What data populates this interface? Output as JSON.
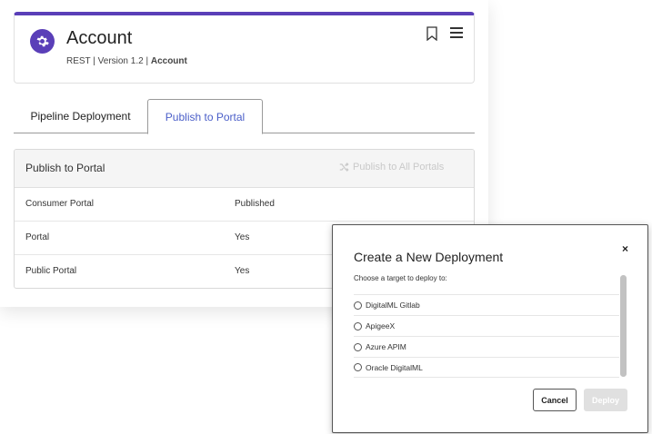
{
  "header": {
    "title": "Account",
    "subtitle_prefix": "REST | Version 1.2 | ",
    "subtitle_bold": "Account",
    "accent_color": "#5a3fb8"
  },
  "tabs": [
    {
      "label": "Pipeline Deployment",
      "active": false
    },
    {
      "label": "Publish to Portal",
      "active": true
    }
  ],
  "publish_card": {
    "title": "Publish to Portal",
    "publish_all_label": "Publish to All Portals",
    "columns": [
      "Consumer Portal",
      "Published"
    ],
    "rows": [
      [
        "Portal",
        "Yes"
      ],
      [
        "Public Portal",
        "Yes"
      ]
    ]
  },
  "modal": {
    "title": "Create a New Deployment",
    "close_label": "×",
    "subtitle": "Choose a target to deploy to:",
    "options": [
      "DigitalML Gitlab",
      "ApigeeX",
      "Azure APIM",
      "Oracle DigitalML"
    ],
    "cancel_label": "Cancel",
    "deploy_label": "Deploy"
  }
}
